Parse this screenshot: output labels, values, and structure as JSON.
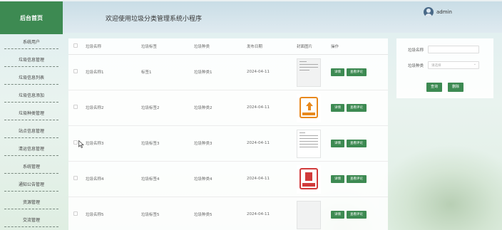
{
  "header": {
    "logo": "后台首页",
    "title": "欢迎使用垃圾分类管理系统小程序",
    "username": "admin"
  },
  "sidebar": {
    "items": [
      {
        "label": "系统用户"
      },
      {
        "label": "垃圾信息管理"
      },
      {
        "label": "垃圾信息列表"
      },
      {
        "label": "垃圾信息添加"
      },
      {
        "label": "垃圾种类管理"
      },
      {
        "label": "站点信息管理"
      },
      {
        "label": "清运信息管理"
      },
      {
        "label": "系统管理"
      },
      {
        "label": "通知公告管理"
      },
      {
        "label": "资源管理"
      },
      {
        "label": "交流管理"
      }
    ]
  },
  "table": {
    "headers": {
      "name": "垃圾名称",
      "tag": "垃圾标签",
      "kind": "垃圾种类",
      "date": "发布日期",
      "image": "封面图片",
      "action": "操作"
    },
    "rows": [
      {
        "name": "垃圾名称1",
        "tag": "标签1",
        "kind": "垃圾种类1",
        "date": "2024-04-11",
        "image": "text"
      },
      {
        "name": "垃圾名称2",
        "tag": "垃圾标签2",
        "kind": "垃圾种类2",
        "date": "2024-04-11",
        "image": "orange-sign"
      },
      {
        "name": "垃圾名称3",
        "tag": "垃圾标签3",
        "kind": "垃圾种类3",
        "date": "2024-04-11",
        "image": "text"
      },
      {
        "name": "垃圾名称4",
        "tag": "垃圾标签4",
        "kind": "垃圾种类4",
        "date": "2024-04-11",
        "image": "red-sign"
      },
      {
        "name": "垃圾名称5",
        "tag": "垃圾标签5",
        "kind": "垃圾种类5",
        "date": "2024-04-11",
        "image": "blank"
      }
    ],
    "detail_label": "详情",
    "comment_label": "查看评论"
  },
  "search": {
    "name_label": "垃圾名称",
    "name_placeholder": "",
    "kind_label": "垃圾种类",
    "kind_placeholder": "请选择",
    "query_label": "查询",
    "delete_label": "删除"
  },
  "colors": {
    "accent": "#3d8a52"
  }
}
